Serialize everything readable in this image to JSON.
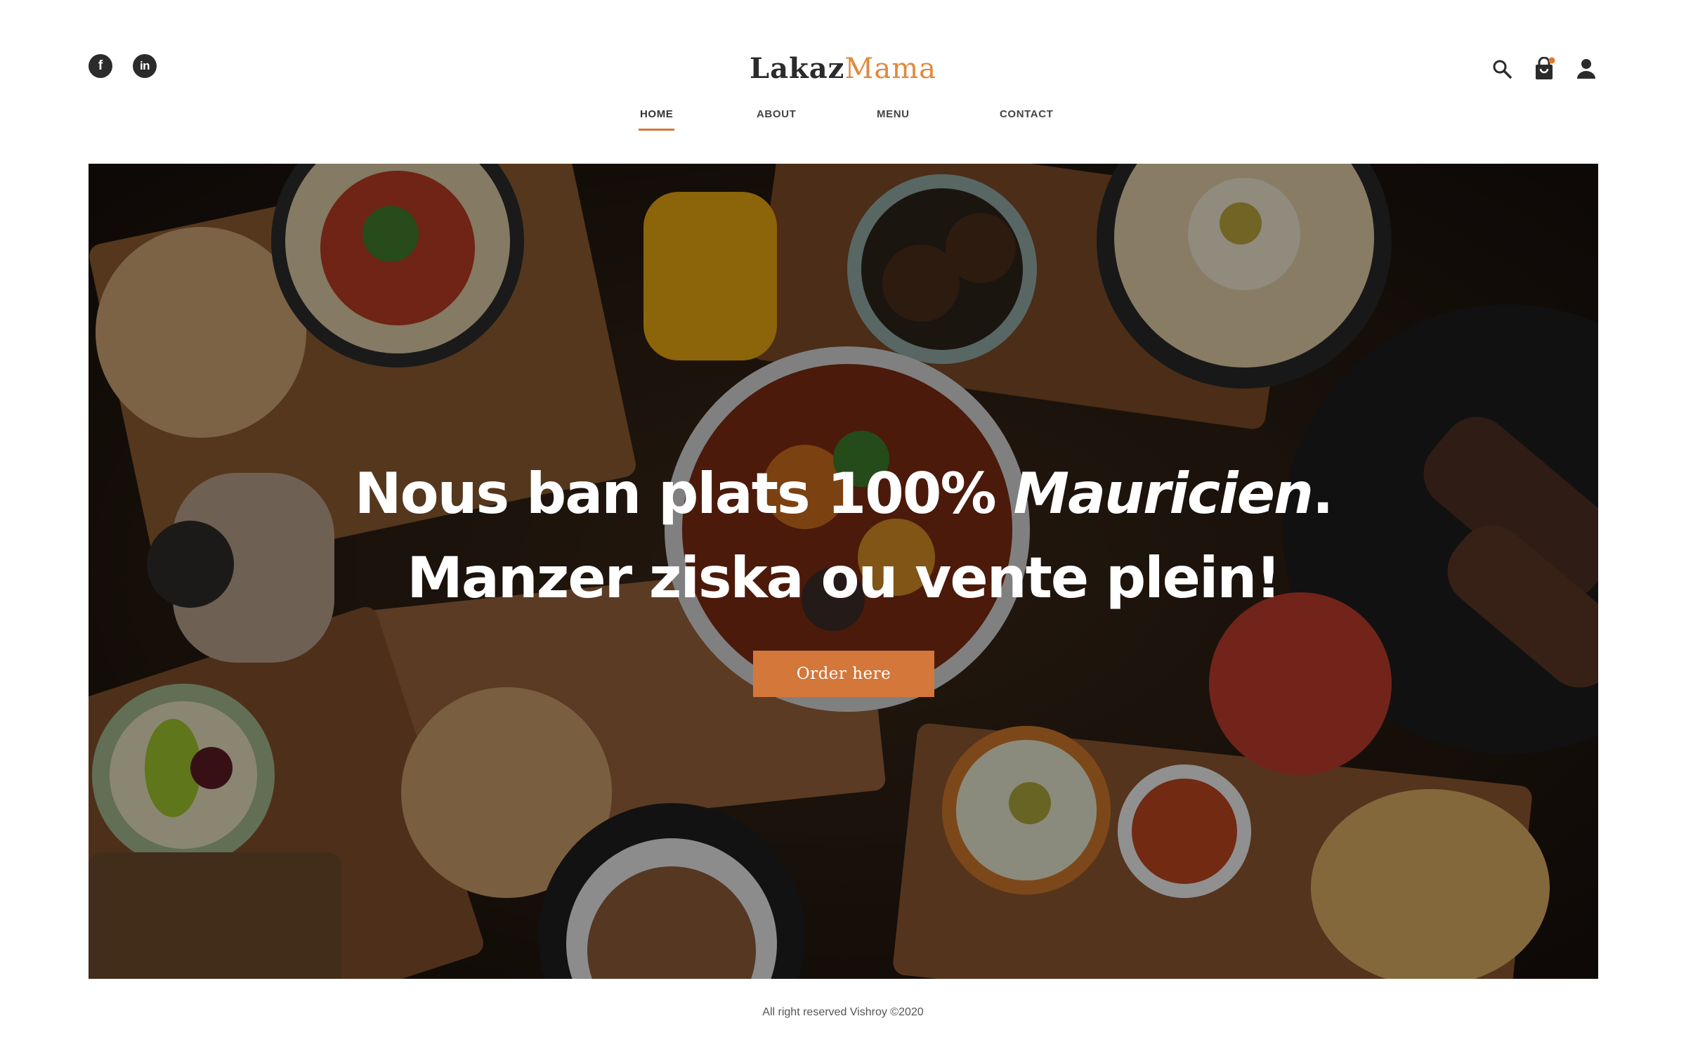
{
  "header": {
    "social": [
      {
        "label": "f",
        "icon": "facebook-icon"
      },
      {
        "label": "in",
        "icon": "linkedin-icon"
      }
    ],
    "logo": {
      "part1": "Lakaz",
      "part2": "Mama"
    },
    "nav": [
      {
        "label": "HOME",
        "active": true
      },
      {
        "label": "ABOUT",
        "active": false
      },
      {
        "label": "MENU",
        "active": false
      },
      {
        "label": "CONTACT",
        "active": false
      }
    ],
    "tools": [
      {
        "icon": "search-icon"
      },
      {
        "icon": "shopping-bag-icon"
      },
      {
        "icon": "user-icon"
      }
    ]
  },
  "hero": {
    "line1_a": "Nous ban plats 100%",
    "line1_em": "Mauricien",
    "line1_end": ".",
    "line2": "Manzer ziska ou vente plein!",
    "cta_label": "Order here"
  },
  "footer": {
    "text": "All right reserved Vishroy ©2020"
  },
  "colors": {
    "accent": "#d4773a",
    "logo_accent": "#e08a3c",
    "dark": "#2b2b2b"
  }
}
